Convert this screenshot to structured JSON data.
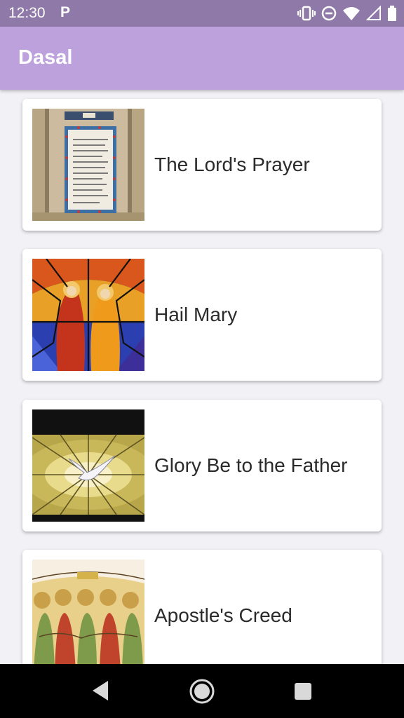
{
  "status": {
    "time": "12:30",
    "notification_icon": "P"
  },
  "app": {
    "title": "Dasal"
  },
  "prayers": [
    {
      "title": "The Lord's Prayer",
      "image": "pater-noster-tile-panel"
    },
    {
      "title": "Hail Mary",
      "image": "annunciation-stained-glass"
    },
    {
      "title": "Glory Be to the Father",
      "image": "holy-spirit-dove-stained-glass"
    },
    {
      "title": "Apostle's Creed",
      "image": "apostles-painting"
    }
  ],
  "icons": [
    "vibrate-icon",
    "do-not-disturb-icon",
    "wifi-icon",
    "signal-icon",
    "battery-icon",
    "back-icon",
    "home-icon",
    "recents-icon"
  ],
  "colors": {
    "app_bar": "#bca1dc",
    "status_bar": "#8f79a8",
    "background": "#f2f1f6"
  }
}
